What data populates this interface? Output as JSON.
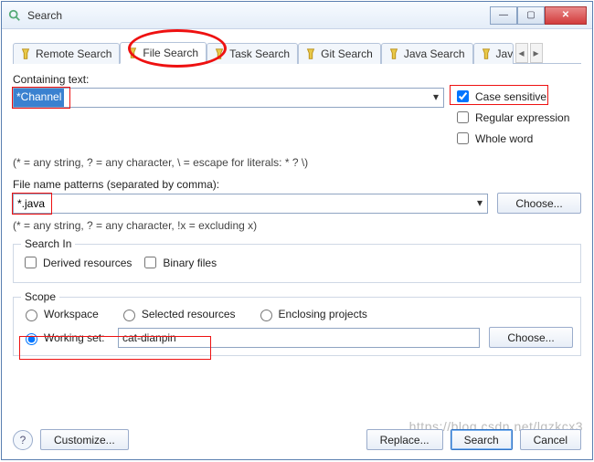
{
  "window": {
    "title": "Search"
  },
  "tabs": {
    "remote": "Remote Search",
    "file": "File Search",
    "task": "Task Search",
    "git": "Git Search",
    "java": "Java Search",
    "java2": "Java"
  },
  "containing": {
    "label": "Containing text:",
    "value": "*Channel",
    "hint": "(* = any string, ? = any character, \\ = escape for literals: * ? \\)"
  },
  "options": {
    "case": "Case sensitive",
    "regex": "Regular expression",
    "whole": "Whole word"
  },
  "patterns": {
    "label": "File name patterns (separated by comma):",
    "value": "*.java",
    "choose": "Choose...",
    "hint": "(* = any string, ? = any character, !x = excluding x)"
  },
  "searchin": {
    "legend": "Search In",
    "derived": "Derived resources",
    "binary": "Binary files"
  },
  "scope": {
    "legend": "Scope",
    "workspace": "Workspace",
    "selected": "Selected resources",
    "enclosing": "Enclosing projects",
    "workingset": "Working set:",
    "wsvalue": "cat-dianpin",
    "choose": "Choose..."
  },
  "footer": {
    "customize": "Customize...",
    "replace": "Replace...",
    "search": "Search",
    "cancel": "Cancel"
  },
  "watermark": "https://blog.csdn.net/lqzkcx3"
}
